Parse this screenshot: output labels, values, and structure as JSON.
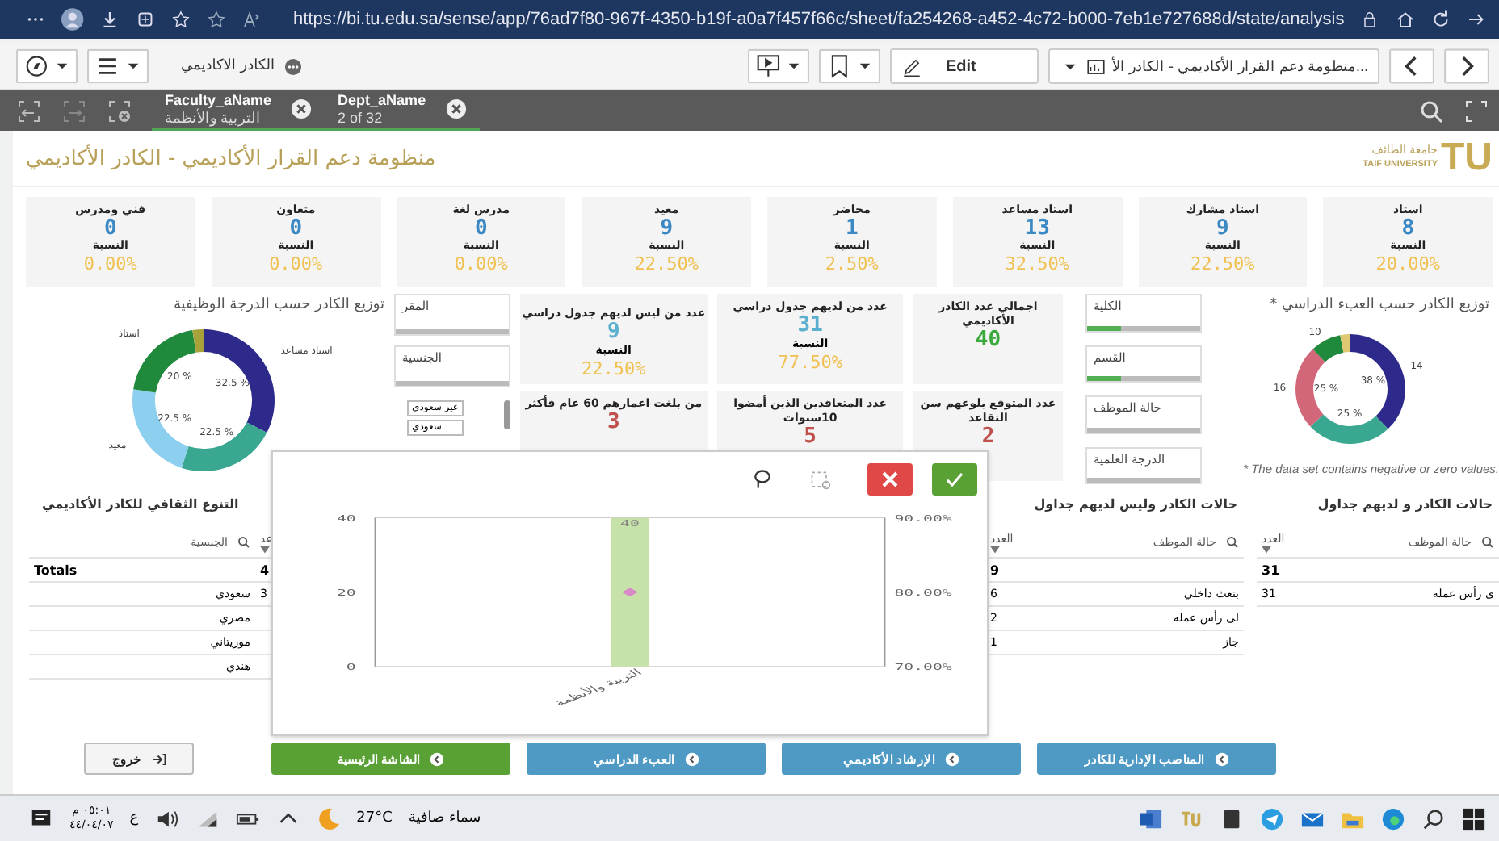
{
  "browser": {
    "url": "https://bi.tu.edu.sa/sense/app/76ad7f80-967f-4350-b19f-a0a7f457f66c/sheet/fa254268-a452-4c72-b000-7eb1e727688d/state/analysis"
  },
  "toolbar": {
    "app_name": "الكادر الاكاديمي",
    "edit": "Edit",
    "sheet_title": "منظومة دعم القرار الأكاديمي - الكادر الأ..."
  },
  "selections": [
    {
      "field": "Dept_aName",
      "value": "2 of 32"
    },
    {
      "field": "Faculty_aName",
      "value": "التربية والأنظمة"
    }
  ],
  "header": {
    "title": "منظومة دعم القرار الأكاديمي - الكادر الأكاديمي",
    "logo_mark": "TU",
    "logo_arabic": "جامعة الطائف",
    "logo_english": "TAIF UNIVERSITY"
  },
  "rank_kpis": [
    {
      "label": "استاذ",
      "value": "8",
      "ratio_label": "النسبة",
      "ratio": "20.00%"
    },
    {
      "label": "استاذ مشارك",
      "value": "9",
      "ratio_label": "النسبة",
      "ratio": "22.50%"
    },
    {
      "label": "استاذ مساعد",
      "value": "13",
      "ratio_label": "النسبة",
      "ratio": "32.50%"
    },
    {
      "label": "محاضر",
      "value": "1",
      "ratio_label": "النسبة",
      "ratio": "2.50%"
    },
    {
      "label": "معيد",
      "value": "9",
      "ratio_label": "النسبة",
      "ratio": "22.50%"
    },
    {
      "label": "مدرس لغة",
      "value": "0",
      "ratio_label": "النسبة",
      "ratio": "0.00%"
    },
    {
      "label": "متعاون",
      "value": "0",
      "ratio_label": "النسبة",
      "ratio": "0.00%"
    },
    {
      "label": "فني ومدرس",
      "value": "0",
      "ratio_label": "النسبة",
      "ratio": "0.00%"
    }
  ],
  "left_donut": {
    "title": "توزيع الكادر حسب الدرجة الوظيفية",
    "chart_data": {
      "type": "donut",
      "categories": [
        "استاذ مساعد",
        null,
        "معيد",
        "استاذ",
        null
      ],
      "values": [
        32.5,
        22.5,
        22.5,
        20,
        2.5
      ],
      "colors": [
        "#2e2a8c",
        "#3aa891",
        "#8ccfee",
        "#1f8a3c",
        "#a8a23a"
      ],
      "value_labels": [
        "32.5 %",
        "22.5 %",
        "22.5 %",
        "20 %",
        null
      ]
    }
  },
  "filters_left": [
    {
      "label": "المقر",
      "has_selection": false
    },
    {
      "label": "الجنسية",
      "has_selection": false
    }
  ],
  "nationality_list": [
    {
      "label": "غير سعودي"
    },
    {
      "label": "سعودي"
    }
  ],
  "kpis": [
    {
      "title": "اجمالي عدد الكادر الأكاديمي",
      "value": "40",
      "color": "#3aa83a"
    },
    {
      "title": "عدد من لديهم جدول دراسي",
      "value": "31",
      "color": "#5bb0cf",
      "ratio_label": "النسبة",
      "ratio": "77.50%"
    },
    {
      "title": "عدد من ليس لديهم جدول دراسي",
      "value": "9",
      "color": "#5bb0cf",
      "ratio_label": "النسبة",
      "ratio": "22.50%"
    },
    {
      "title": "عدد المتوقع بلوغهم سن التقاعد",
      "value": "2",
      "color": "#c0504d"
    },
    {
      "title": "عدد المتعاقدين الذين أمضوا 10سنوات",
      "value": "5",
      "color": "#c0504d"
    },
    {
      "title": "من بلغت اعمارهم 60 عام فأكثر",
      "value": "3",
      "color": "#c0504d"
    }
  ],
  "filters_right": [
    {
      "label": "الكلية",
      "has_selection": true
    },
    {
      "label": "القسم",
      "has_selection": true
    },
    {
      "label": "حالة الموظف",
      "has_selection": false
    },
    {
      "label": "الدرجة العلمية",
      "has_selection": false
    }
  ],
  "right_donut": {
    "title": "* توزيع الكادر حسب العبء الدراسي",
    "note": "* The data set contains negative or zero values.",
    "chart_data": {
      "type": "donut",
      "categories": [
        "14",
        null,
        "16",
        "10",
        null
      ],
      "values": [
        38,
        25,
        25,
        9,
        3
      ],
      "colors": [
        "#2e2a8c",
        "#3aa891",
        "#d2677a",
        "#1f8a3c",
        "#e0c870"
      ],
      "value_labels": [
        "38 %",
        "25 %",
        "25 %",
        null,
        null
      ]
    }
  },
  "popup": {
    "right_ticks": [
      "90.00%",
      "80.00%",
      "70.00%"
    ],
    "chart_data": {
      "type": "bar",
      "categories": [
        "التربية والأنظمة"
      ],
      "series": [
        {
          "color": "#c6e2a9",
          "values": [
            40
          ]
        }
      ],
      "ylim": [
        0,
        40
      ],
      "yticks": [
        0,
        20,
        40
      ],
      "data_labels": true
    }
  },
  "tables": [
    {
      "title": "حالات الكادر و لديهم جداول",
      "columns": [
        {
          "label": "حالة الموظف",
          "search": true
        },
        {
          "label": "العدد",
          "search": false
        }
      ],
      "totals": {
        "count": "31"
      },
      "rows": [
        {
          "name": "ى رأس عمله",
          "count": "31"
        }
      ]
    },
    {
      "title": "حالات الكادر وليس لديهم جداول",
      "columns": [
        {
          "label": "حالة الموظف",
          "search": true
        },
        {
          "label": "العدد",
          "search": false
        }
      ],
      "totals": {
        "count": "9"
      },
      "rows": [
        {
          "name": "بتعث داخلي",
          "count": "6"
        },
        {
          "name": "لى رأس عمله",
          "count": "2"
        },
        {
          "name": "جاز",
          "count": "1"
        }
      ]
    },
    {
      "title": "التنوع الثقافي للكادر الأكاديمي",
      "columns": [
        {
          "label": "عد",
          "search": false
        },
        {
          "label": "الجنسية",
          "search": true
        }
      ],
      "totals": {
        "label": "Totals",
        "count": "4"
      },
      "rows": [
        {
          "name": "سعودي",
          "count": "3"
        },
        {
          "name": "مصري"
        },
        {
          "name": "موريتاني"
        },
        {
          "name": "هندي"
        }
      ]
    }
  ],
  "nav_buttons": [
    {
      "label": "المناصب الإدارية للكادر",
      "kind": "nav"
    },
    {
      "label": "الإرشاد الأكاديمي",
      "kind": "nav"
    },
    {
      "label": "العبء الدراسي",
      "kind": "nav"
    },
    {
      "label": "الشاشة الرئيسية",
      "kind": "home"
    },
    {
      "label": "خروج",
      "kind": "exit"
    }
  ],
  "taskbar": {
    "time": "٠٥:٠١ م",
    "date": "٤٤/٠٤/٠٧",
    "language": "ع",
    "weather": "سماء صافية",
    "temperature": "27°C"
  }
}
